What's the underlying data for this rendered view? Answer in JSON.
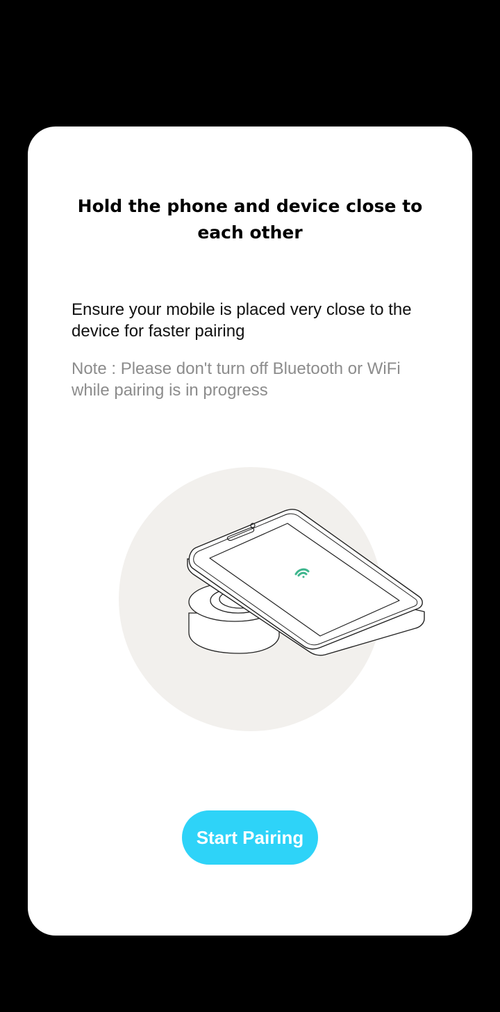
{
  "dialog": {
    "title": "Hold the phone and device close to each other",
    "instruction": "Ensure your mobile is placed very close to the device for faster pairing",
    "note": "Note : Please don't turn off Bluetooth or WiFi while pairing is in progress",
    "illustration_icon": "phone-on-device-pairing-icon",
    "signal_icon": "wifi-signal-icon",
    "start_button_label": "Start Pairing"
  },
  "colors": {
    "background": "#000000",
    "dialog_background": "#ffffff",
    "illustration_circle": "#f2f0ed",
    "signal_green": "#3fb68e",
    "button_accent": "#2ed3f8",
    "note_gray": "#8c8c8c"
  }
}
